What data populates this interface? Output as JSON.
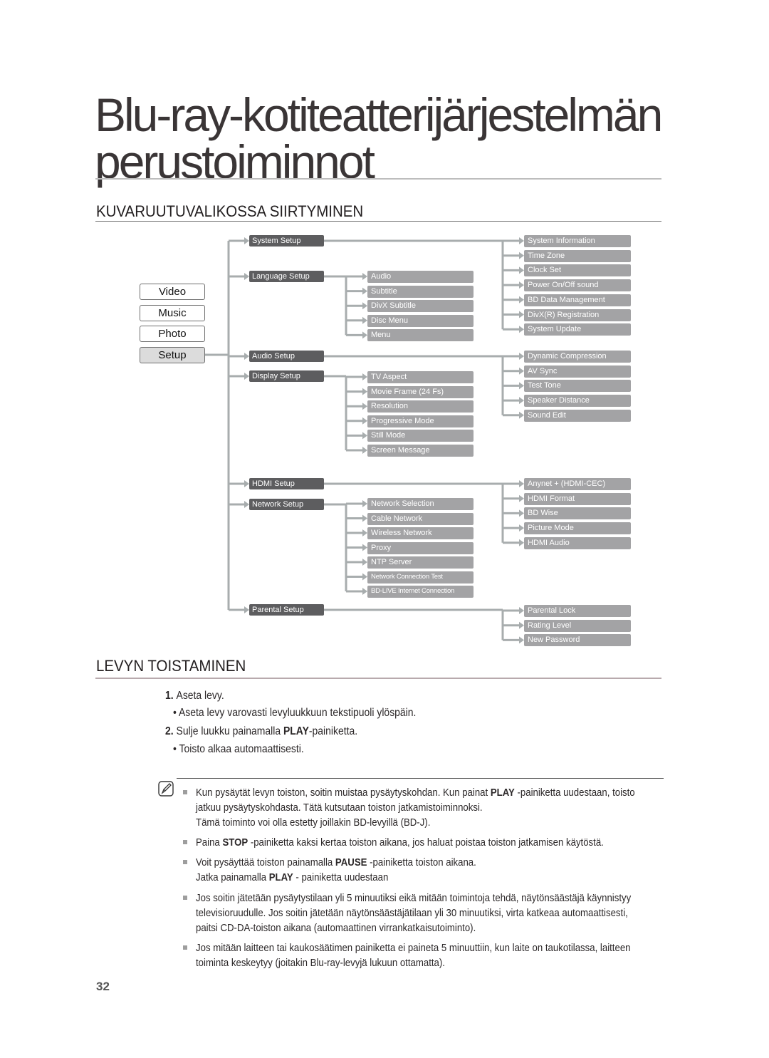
{
  "title": {
    "line1": "Blu-ray-kotiteatterijärjestelmän",
    "line2": "perustoiminnot"
  },
  "section1": {
    "heading": "KUVARUUTUVALIKOSSA SIIRTYMINEN"
  },
  "main_menu": [
    {
      "label": "Video",
      "active": false
    },
    {
      "label": "Music",
      "active": false
    },
    {
      "label": "Photo",
      "active": false
    },
    {
      "label": "Setup",
      "active": true
    }
  ],
  "setup_menu": [
    {
      "label": "System Setup",
      "children": [
        "System Information",
        "Time Zone",
        "Clock Set",
        "Power On/Off sound",
        "BD Data Management",
        "DivX(R) Registration",
        "System Update"
      ]
    },
    {
      "label": "Language Setup",
      "children": [
        "Audio",
        "Subtitle",
        "DivX Subtitle",
        "Disc Menu",
        "Menu"
      ]
    },
    {
      "label": "Audio Setup",
      "children": [
        "Dynamic Compression",
        "AV Sync",
        "Test Tone",
        "Speaker Distance",
        "Sound Edit"
      ]
    },
    {
      "label": "Display Setup",
      "children": [
        "TV Aspect",
        "Movie Frame (24 Fs)",
        "Resolution",
        "Progressive Mode",
        "Still Mode",
        "Screen Message"
      ]
    },
    {
      "label": "HDMI Setup",
      "children": [
        "Anynet + (HDMI-CEC)",
        "HDMI Format",
        "BD Wise",
        "Picture Mode",
        "HDMI Audio"
      ]
    },
    {
      "label": "Network Setup",
      "children": [
        "Network Selection",
        "Cable Network",
        "Wireless Network",
        "Proxy",
        "NTP Server",
        "Network Connection Test",
        "BD-LIVE Internet Connection"
      ]
    },
    {
      "label": "Parental Setup",
      "children": [
        "Parental Lock",
        "Rating Level",
        "New Password"
      ]
    }
  ],
  "section2": {
    "heading": "LEVYN TOISTAMINEN",
    "steps": [
      {
        "num": "1.",
        "text": "Aseta levy."
      },
      {
        "bullet": "•",
        "text": "Aseta levy varovasti levyluukkuun tekstipuoli ylöspäin."
      },
      {
        "num": "2.",
        "pre": "Sulje luukku painamalla ",
        "bold": "PLAY",
        "post": "-painiketta."
      },
      {
        "bullet": "•",
        "text": "Toisto alkaa automaattisesti."
      }
    ],
    "notes": [
      {
        "lines": [
          {
            "pre": "Kun pysäytät levyn toiston, soitin muistaa pysäytyskohdan. Kun painat ",
            "bold": "PLAY",
            "post": " -painiketta uudestaan, toisto"
          },
          {
            "pre": "jatkuu pysäytyskohdasta. Tätä kutsutaan toiston jatkamistoiminnoksi."
          },
          {
            "pre": "Tämä toiminto voi olla estetty joillakin BD-levyillä (BD-J)."
          }
        ]
      },
      {
        "lines": [
          {
            "pre": "Paina ",
            "bold": "STOP",
            "post": " -painiketta kaksi kertaa toiston aikana, jos haluat poistaa toiston jatkamisen käytöstä."
          }
        ]
      },
      {
        "lines": [
          {
            "pre": "Voit pysäyttää toiston painamalla ",
            "bold": "PAUSE",
            "post": " -painiketta toiston aikana."
          },
          {
            "pre": "Jatka painamalla ",
            "bold": "PLAY",
            "post": " - painiketta uudestaan"
          }
        ]
      },
      {
        "lines": [
          {
            "pre": "Jos soitin jätetään pysäytystilaan yli 5 minuutiksi eikä mitään toimintoja tehdä, näytönsäästäjä käynnistyy"
          },
          {
            "pre": "televisioruudulle. Jos soitin jätetään näytönsäästäjätilaan yli 30 minuutiksi, virta katkeaa automaattisesti,"
          },
          {
            "pre": "paitsi CD-DA-toiston aikana (automaattinen virrankatkaisutoiminto)."
          }
        ]
      },
      {
        "lines": [
          {
            "pre": "Jos mitään laitteen tai kaukosäätimen painiketta ei paineta 5 minuuttiin, kun laite on taukotilassa, laitteen"
          },
          {
            "pre": "toiminta keskeytyy (joitakin Blu-ray-levyjä lukuun ottamatta)."
          }
        ]
      }
    ]
  },
  "page_number": "32",
  "colors": {
    "level1_box": "#5d5d5f",
    "level2_box": "#a3a3a5",
    "connector": "#a8adae",
    "active_menu": "#dcdcdc"
  }
}
